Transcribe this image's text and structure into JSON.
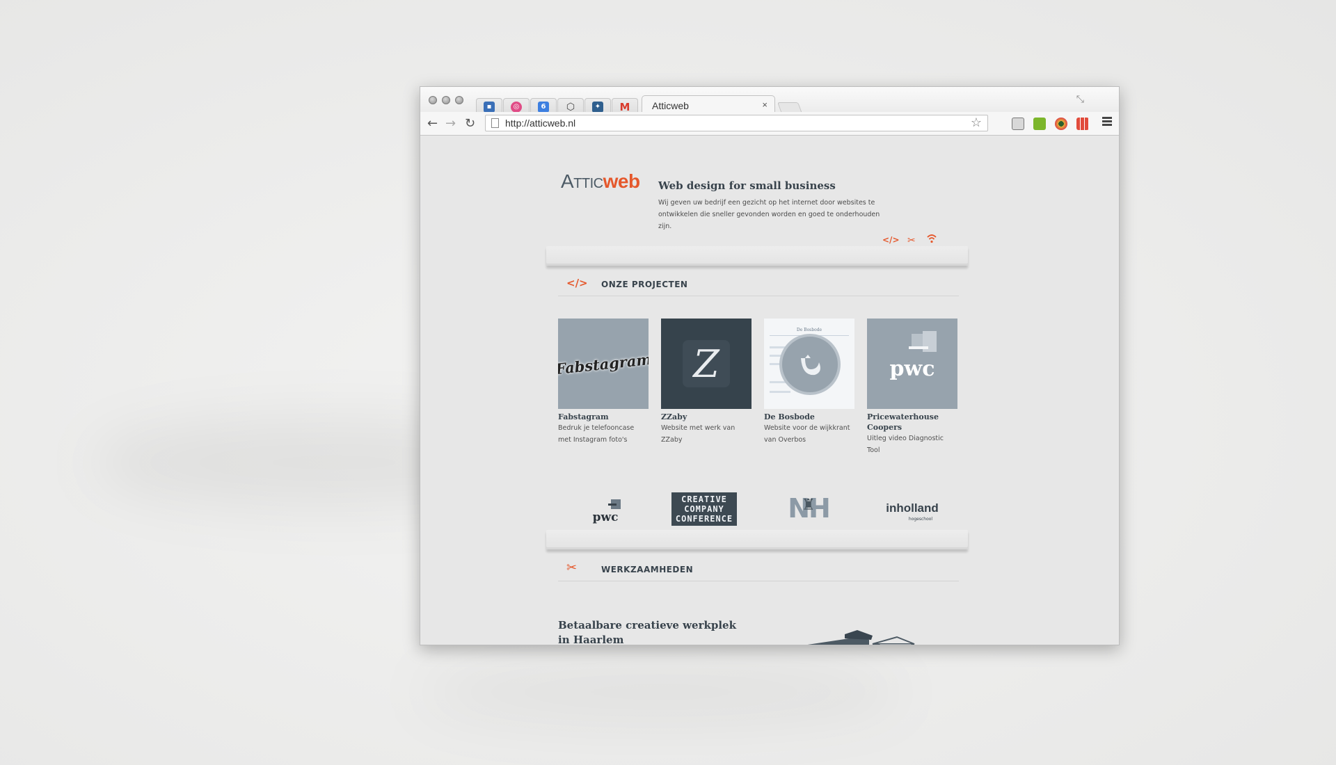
{
  "browser": {
    "active_tab_title": "Atticweb",
    "tab_close": "×",
    "url": "http://atticweb.nl",
    "pinned_tabs": [
      "feed-icon",
      "dribbble-icon",
      "calendar-icon",
      "codepen-icon",
      "twitter-icon",
      "gmail-icon"
    ],
    "calendar_day": "6",
    "gmail_letter": "M",
    "extensions": [
      "evernote-icon",
      "speaker-icon",
      "eye-icon",
      "grid-icon"
    ]
  },
  "header": {
    "logo_attic": "Attic",
    "logo_web": "web",
    "tagline": "Web design for small business",
    "intro": "Wij geven uw bedrijf een gezicht op het internet door websites te ontwikkelen die sneller gevonden worden en goed te onderhouden zijn.",
    "shelf_icons": [
      "code-icon",
      "scissors-icon",
      "wifi-icon"
    ]
  },
  "projects_section": {
    "icon_text": "</>",
    "title": "ONZE PROJECTEN",
    "items": [
      {
        "title": "Fabstagram",
        "desc": "Bedruk je telefooncase met Instagram foto's",
        "thumb_text": "Fabstagram",
        "thumb_color": "#97a3ad"
      },
      {
        "title": "ZZaby",
        "desc": "Website met werk van ZZaby",
        "thumb_text": "Z",
        "thumb_color": "#36434c"
      },
      {
        "title": "De Bosbode",
        "desc": "Website voor de wijkkrant van Overbos",
        "thumb_text": "De Bosbode",
        "thumb_color": "#f4f6f8"
      },
      {
        "title": "Pricewaterhouse Coopers",
        "desc": "Uitleg video Diagnostic Tool",
        "thumb_text": "pwc",
        "thumb_color": "#97a3ad"
      }
    ]
  },
  "clients": {
    "pwc": "pwc",
    "ccc_lines": [
      "CREATIVE",
      "COMPANY",
      "CONFERENCE"
    ],
    "nh": "NH",
    "inholland": "inholland",
    "inholland_sub": "hogeschool"
  },
  "werk_section": {
    "icon_text": "✂",
    "title": "WERKZAAMHEDEN",
    "article_title": "Betaalbare creatieve werkplek in Haarlem"
  },
  "colors": {
    "accent": "#e5582c",
    "dark": "#38434c"
  }
}
